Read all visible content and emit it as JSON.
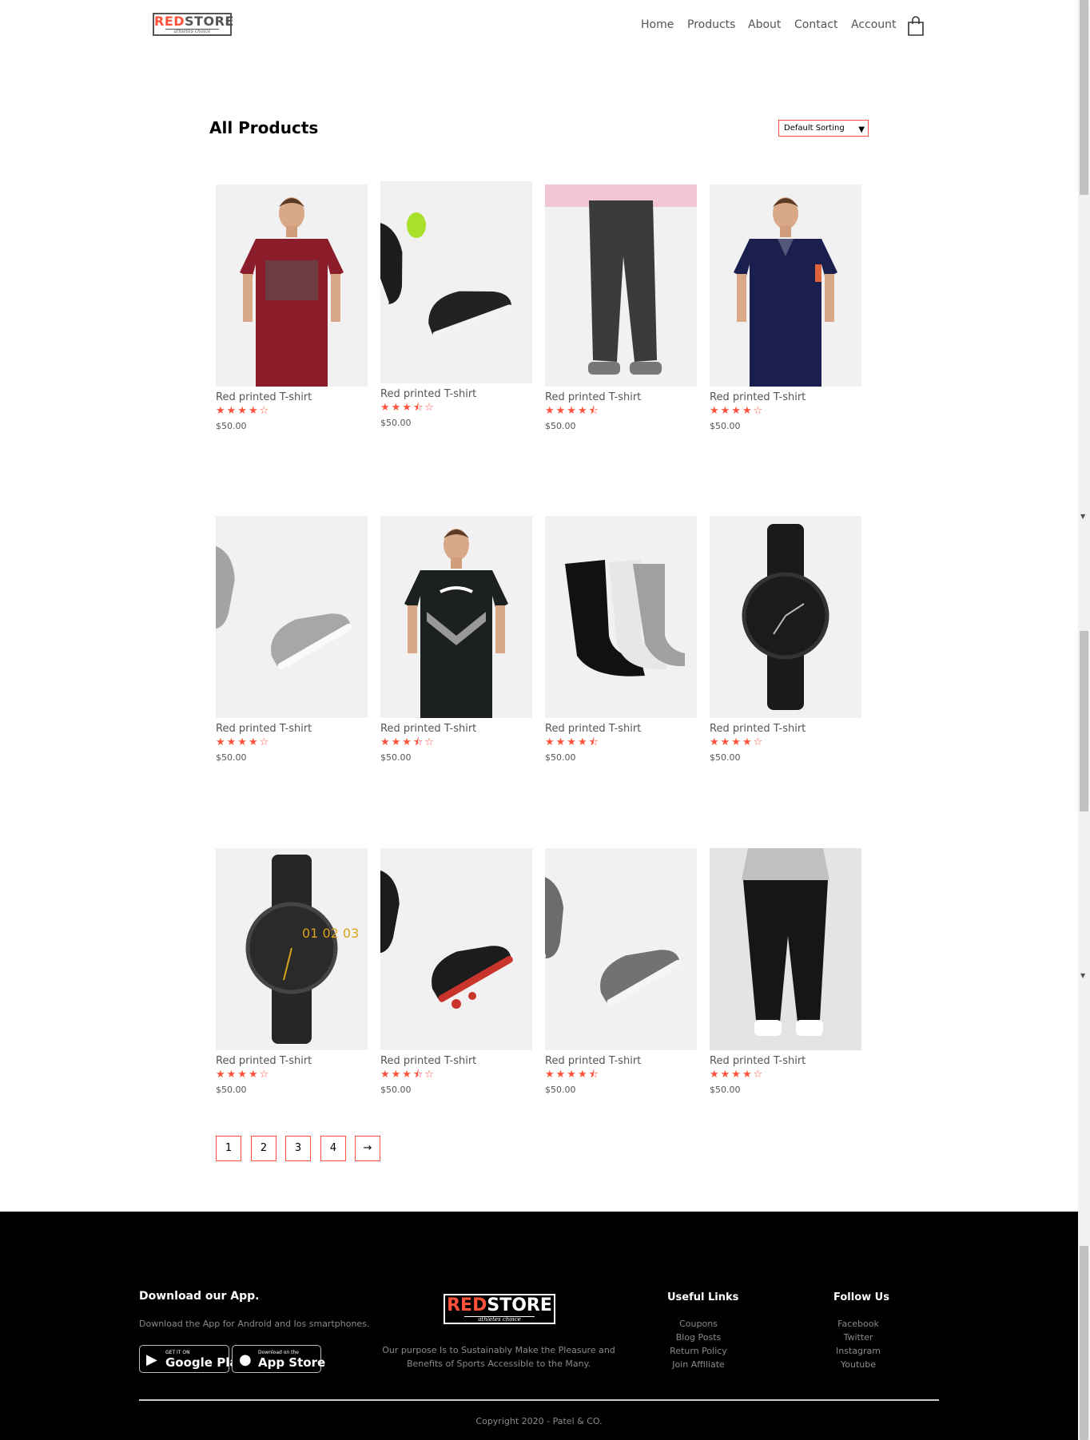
{
  "brand": {
    "name_red": "RED",
    "name_rest": "STORE",
    "tagline": "athletes choice"
  },
  "nav": {
    "items": [
      "Home",
      "Products",
      "About",
      "Contact",
      "Account"
    ],
    "cart_icon": "shopping-bag-icon"
  },
  "page": {
    "title": "All Products",
    "sort_selected": "Default Sorting"
  },
  "colors": {
    "accent": "#ff523b",
    "footer_bg": "#000000",
    "image_bg": "#f1f1f1"
  },
  "products": [
    {
      "name": "Red printed T-shirt",
      "rating": 4,
      "price": "$50.00",
      "image": "red-tshirt"
    },
    {
      "name": "Red printed T-shirt",
      "rating": 3.5,
      "price": "$50.00",
      "image": "black-shoes"
    },
    {
      "name": "Red printed T-shirt",
      "rating": 4.5,
      "price": "$50.00",
      "image": "grey-trousers"
    },
    {
      "name": "Red printed T-shirt",
      "rating": 4,
      "price": "$50.00",
      "image": "navy-polo"
    },
    {
      "name": "Red printed T-shirt",
      "rating": 4,
      "price": "$50.00",
      "image": "grey-high-tops"
    },
    {
      "name": "Red printed T-shirt",
      "rating": 3.5,
      "price": "$50.00",
      "image": "black-puma-tshirt"
    },
    {
      "name": "Red printed T-shirt",
      "rating": 4.5,
      "price": "$50.00",
      "image": "socks"
    },
    {
      "name": "Red printed T-shirt",
      "rating": 4,
      "price": "$50.00",
      "image": "black-watch"
    },
    {
      "name": "Red printed T-shirt",
      "rating": 4,
      "price": "$50.00",
      "image": "leather-watch"
    },
    {
      "name": "Red printed T-shirt",
      "rating": 3.5,
      "price": "$50.00",
      "image": "red-black-shoes"
    },
    {
      "name": "Red printed T-shirt",
      "rating": 4.5,
      "price": "$50.00",
      "image": "grey-slip-ons"
    },
    {
      "name": "Red printed T-shirt",
      "rating": 4,
      "price": "$50.00",
      "image": "black-joggers"
    }
  ],
  "pagination": {
    "pages": [
      "1",
      "2",
      "3",
      "4"
    ],
    "next": "→"
  },
  "footer": {
    "app": {
      "heading": "Download our App.",
      "text": "Download the App for Android and Ios smartphones.",
      "google_small": "GET IT ON",
      "google_big": "Google Play",
      "apple_small": "Download on the",
      "apple_big": "App Store"
    },
    "about": "Our purpose Is to Sustainably Make the Pleasure and Benefits of Sports Accessible to the Many.",
    "useful_links": {
      "heading": "Useful Links",
      "items": [
        "Coupons",
        "Blog Posts",
        "Return Policy",
        "Join Affiliate"
      ]
    },
    "follow": {
      "heading": "Follow Us",
      "items": [
        "Facebook",
        "Twitter",
        "Instagram",
        "Youtube"
      ]
    },
    "copyright": "Copyright 2020 - Patel & CO."
  }
}
